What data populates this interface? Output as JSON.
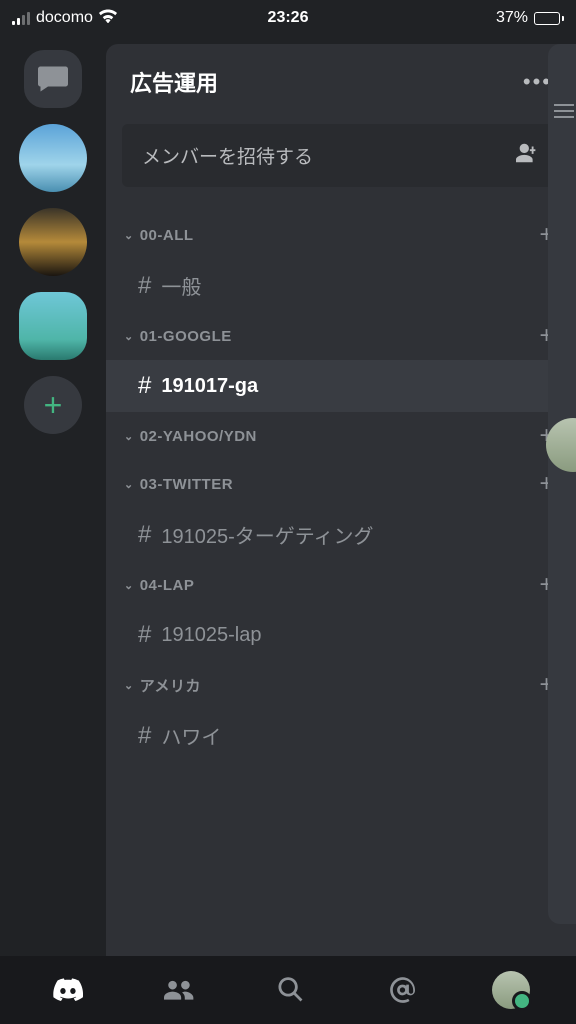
{
  "status": {
    "carrier": "docomo",
    "time": "23:26",
    "battery_pct": "37%"
  },
  "server": {
    "name": "広告運用"
  },
  "invite": {
    "label": "メンバーを招待する"
  },
  "categories": [
    {
      "name": "00-ALL",
      "channels": [
        {
          "name": "一般",
          "selected": false
        }
      ]
    },
    {
      "name": "01-GOOGLE",
      "channels": [
        {
          "name": "191017-ga",
          "selected": true
        }
      ]
    },
    {
      "name": "02-YAHOO/YDN",
      "channels": []
    },
    {
      "name": "03-TWITTER",
      "channels": [
        {
          "name": "191025-ターゲティング",
          "selected": false
        }
      ]
    },
    {
      "name": "04-LAP",
      "channels": [
        {
          "name": "191025-lap",
          "selected": false
        }
      ]
    },
    {
      "name": "アメリカ",
      "channels": [
        {
          "name": "ハワイ",
          "selected": false
        }
      ]
    }
  ]
}
